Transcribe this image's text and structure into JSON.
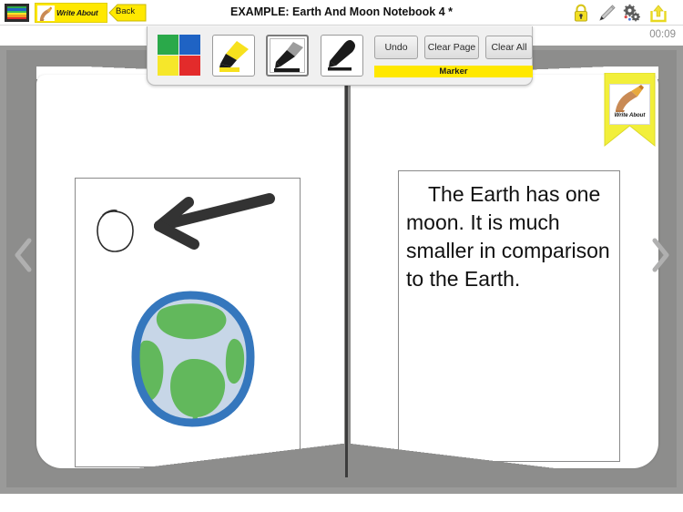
{
  "app": {
    "brand": "Write About",
    "back_label": "Back",
    "title": "EXAMPLE: Earth And Moon Notebook 4 *",
    "timer": "00:09"
  },
  "topbar": {
    "icons": [
      {
        "name": "library-icon",
        "label": "Library"
      },
      {
        "name": "lock-icon",
        "label": "Lock"
      },
      {
        "name": "pencil-icon",
        "label": "Edit"
      },
      {
        "name": "gears-icon",
        "label": "Settings"
      },
      {
        "name": "share-icon",
        "label": "Share"
      }
    ]
  },
  "toolbar": {
    "tools": [
      {
        "name": "color-picker",
        "label": "Color",
        "selected": false
      },
      {
        "name": "highlighter",
        "label": "Highlighter",
        "selected": false
      },
      {
        "name": "marker",
        "label": "Marker",
        "selected": true
      },
      {
        "name": "pen",
        "label": "Pen",
        "selected": false
      }
    ],
    "undo_label": "Undo",
    "clear_page_label": "Clear Page",
    "clear_all_label": "Clear All",
    "status_label": "Marker",
    "colors": {
      "green": "#2aa94a",
      "blue": "#1f63c4",
      "yellow": "#f6e72a",
      "red": "#e32b2b",
      "highlight_bar": "#ffe800"
    }
  },
  "nav": {
    "prev_label": "Previous page",
    "next_label": "Next page"
  },
  "book": {
    "left_page": {
      "drawing": {
        "name": "earth-and-moon-drawing",
        "elements": [
          "moon-outline-circle",
          "black-arrow",
          "earth-sketch"
        ],
        "colors": {
          "earth_outline": "#3577bd",
          "earth_water": "#c7d6e7",
          "earth_land": "#62b85c",
          "arrow": "#333333",
          "moon_outline": "#2b2b2b"
        }
      }
    },
    "right_page": {
      "story_text": "The Earth has one moon. It is much smaller in comparison to the Earth."
    },
    "bookmark": {
      "label": "Write About"
    }
  }
}
